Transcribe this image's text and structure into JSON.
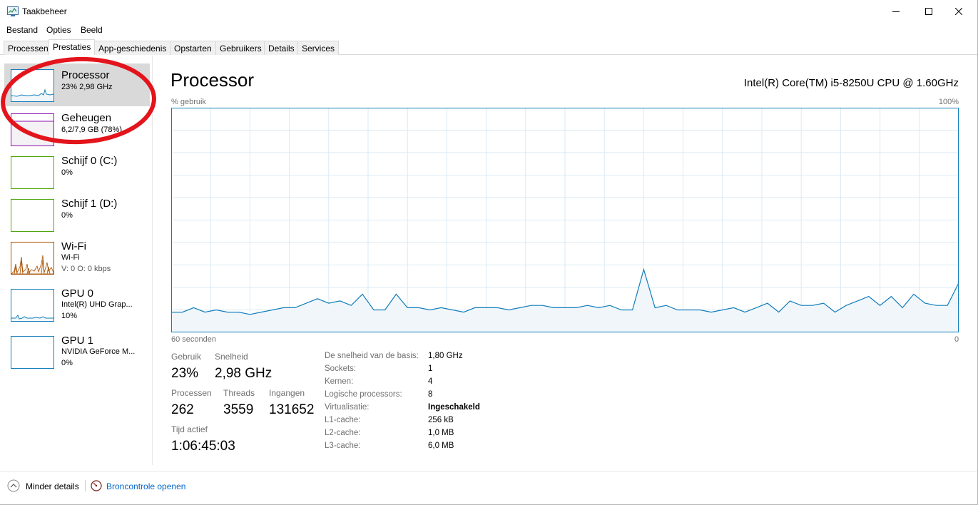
{
  "window": {
    "title": "Taakbeheer",
    "icon": "task-manager-icon"
  },
  "menu": [
    "Bestand",
    "Opties",
    "Beeld"
  ],
  "tabs": [
    {
      "label": "Processen",
      "active": false
    },
    {
      "label": "Prestaties",
      "active": true
    },
    {
      "label": "App-geschiedenis",
      "active": false
    },
    {
      "label": "Opstarten",
      "active": false
    },
    {
      "label": "Gebruikers",
      "active": false
    },
    {
      "label": "Details",
      "active": false
    },
    {
      "label": "Services",
      "active": false
    }
  ],
  "sidebar": {
    "items": [
      {
        "name": "Processor",
        "sub1": "23%  2,98 GHz",
        "sub2": "",
        "selected": true,
        "color": "#117dbb"
      },
      {
        "name": "Geheugen",
        "sub1": "6,2/7,9 GB (78%)",
        "sub2": "",
        "selected": false,
        "color": "#8b12ae"
      },
      {
        "name": "Schijf 0 (C:)",
        "sub1": "0%",
        "sub2": "",
        "selected": false,
        "color": "#4da60c"
      },
      {
        "name": "Schijf 1 (D:)",
        "sub1": "0%",
        "sub2": "",
        "selected": false,
        "color": "#4da60c"
      },
      {
        "name": "Wi-Fi",
        "sub1": "Wi-Fi",
        "sub2": "V: 0  O: 0 kbps",
        "selected": false,
        "color": "#a74f01"
      },
      {
        "name": "GPU 0",
        "sub1": "Intel(R) UHD Grap...",
        "sub2": "10%",
        "selected": false,
        "color": "#117dbb"
      },
      {
        "name": "GPU 1",
        "sub1": "NVIDIA GeForce M...",
        "sub2": "0%",
        "selected": false,
        "color": "#117dbb"
      }
    ]
  },
  "main": {
    "title": "Processor",
    "cpu_model": "Intel(R) Core(TM) i5-8250U CPU @ 1.60GHz",
    "graph": {
      "y_label": "% gebruik",
      "y_max_label": "100%",
      "x_left_label": "60 seconden",
      "x_right_label": "0",
      "line_color": "#117dbb",
      "fill_color": "#f1f6fa",
      "grid_color": "#d9eaf4",
      "usage_percent": [
        9,
        9,
        11,
        9,
        10,
        9,
        9,
        8,
        9,
        10,
        11,
        11,
        13,
        15,
        13,
        14,
        12,
        17,
        10,
        10,
        17,
        11,
        11,
        10,
        11,
        10,
        9,
        11,
        11,
        11,
        10,
        11,
        12,
        12,
        11,
        11,
        11,
        12,
        11,
        12,
        10,
        10,
        28,
        11,
        12,
        10,
        10,
        10,
        9,
        10,
        11,
        9,
        11,
        13,
        9,
        14,
        12,
        12,
        13,
        9,
        12,
        14,
        16,
        12,
        16,
        11,
        17,
        13,
        12,
        12,
        22
      ]
    },
    "stats": {
      "usage_label": "Gebruik",
      "usage_value": "23%",
      "speed_label": "Snelheid",
      "speed_value": "2,98 GHz",
      "processes_label": "Processen",
      "processes_value": "262",
      "threads_label": "Threads",
      "threads_value": "3559",
      "handles_label": "Ingangen",
      "handles_value": "131652",
      "uptime_label": "Tijd actief",
      "uptime_value": "1:06:45:03"
    },
    "info": [
      {
        "label": "De snelheid van de basis:",
        "value": "1,80 GHz",
        "bold": false
      },
      {
        "label": "Sockets:",
        "value": "1",
        "bold": false
      },
      {
        "label": "Kernen:",
        "value": "4",
        "bold": false
      },
      {
        "label": "Logische processors:",
        "value": "8",
        "bold": false
      },
      {
        "label": "Virtualisatie:",
        "value": "Ingeschakeld",
        "bold": true
      },
      {
        "label": "L1-cache:",
        "value": "256 kB",
        "bold": false
      },
      {
        "label": "L2-cache:",
        "value": "1,0 MB",
        "bold": false
      },
      {
        "label": "L3-cache:",
        "value": "6,0 MB",
        "bold": false
      }
    ]
  },
  "footer": {
    "less_details": "Minder details",
    "resource_monitor": "Broncontrole openen"
  }
}
